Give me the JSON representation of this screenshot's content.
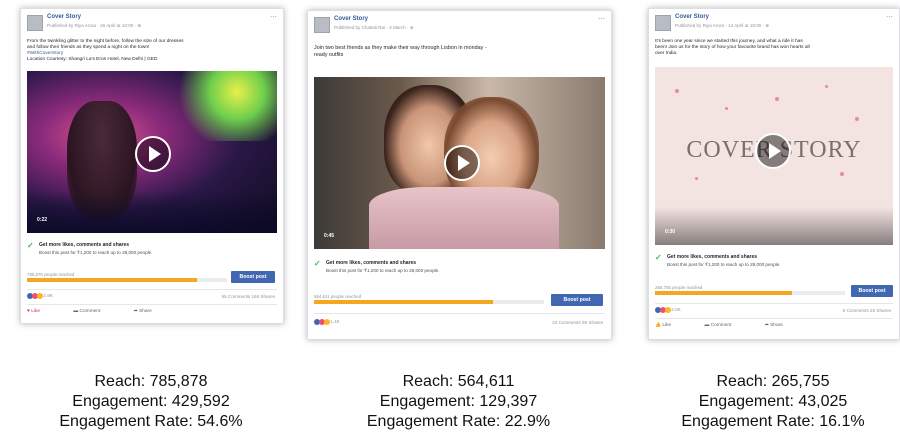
{
  "posts": [
    {
      "page_name": "Cover Story",
      "meta": "Published by Riya Arora · 26 April at 10:00 · ⊕",
      "caption_line1": "From the twinkling glitter to the night before, follow the size of our dresses",
      "caption_line2": "and follow their friends as they spend a night on the town!",
      "caption_line3": "#WithCoverStory",
      "caption_line4": "Location Courtesy: Shangri La's Eros Hotel, New Delhi | GED",
      "duration": "0:22",
      "tip_title": "Get more likes, comments and shares",
      "tip_body": "Boost this post for ₹1,200 to reach up to 28,000 people.",
      "reach_text": "785,878 people reached",
      "reach_fraction": 0.85,
      "boost_label": "Boost post",
      "reactions_count": "2.9K",
      "comments_text": "65 Comments  166 Shares",
      "action_like": "Like",
      "action_comment": "Comment",
      "action_share": "Share",
      "reach_stat": "Reach: 785,878",
      "engagement_stat": "Engagement: 429,592",
      "rate_stat": "Engagement Rate: 54.6%"
    },
    {
      "page_name": "Cover Story",
      "meta": "Published by Chaitali Rai · 3 March · ⊕",
      "caption_line1": "Join two best friends as they make their way through Lisbon in monday -",
      "caption_line2": "ready outfits",
      "duration": "0:45",
      "tip_title": "Get more likes, comments and shares",
      "tip_body": "Boost this post for ₹1,200 to reach up to 28,000 people.",
      "reach_text": "564,611 people reached",
      "reach_fraction": 0.78,
      "boost_label": "Boost post",
      "reactions_count": "1.4K",
      "comments_text": "23 Comments  96 Shares",
      "reach_stat": "Reach: 564,611",
      "engagement_stat": "Engagement: 129,397",
      "rate_stat": "Engagement Rate: 22.9%"
    },
    {
      "page_name": "Cover Story",
      "meta": "Published by Riya Arora · 14 April at 18:00 · ⊕",
      "caption_line1": "It's been one year since we started this journey, and what a ride it has",
      "caption_line2": "been! Join us for the story of how your favourite brand has won hearts all",
      "caption_line3": "over India.",
      "logo_text": "COVER STORY",
      "duration": "0:30",
      "tip_title": "Get more likes, comments and shares",
      "tip_body": "Boost this post for ₹1,200 to reach up to 28,000 people.",
      "reach_text": "265,755 people reached",
      "reach_fraction": 0.72,
      "boost_label": "Boost post",
      "reactions_count": "2.0K",
      "comments_text": "8 Comments  25 Shares",
      "action_like": "Like",
      "action_comment": "Comment",
      "action_share": "Share",
      "reach_stat": "Reach: 265,755",
      "engagement_stat": "Engagement: 43,025",
      "rate_stat": "Engagement Rate: 16.1%"
    }
  ],
  "colors": {
    "link_blue": "#365899",
    "boost_blue": "#4267b2",
    "reach_orange": "#f5a623",
    "check_green": "#4caf50"
  }
}
